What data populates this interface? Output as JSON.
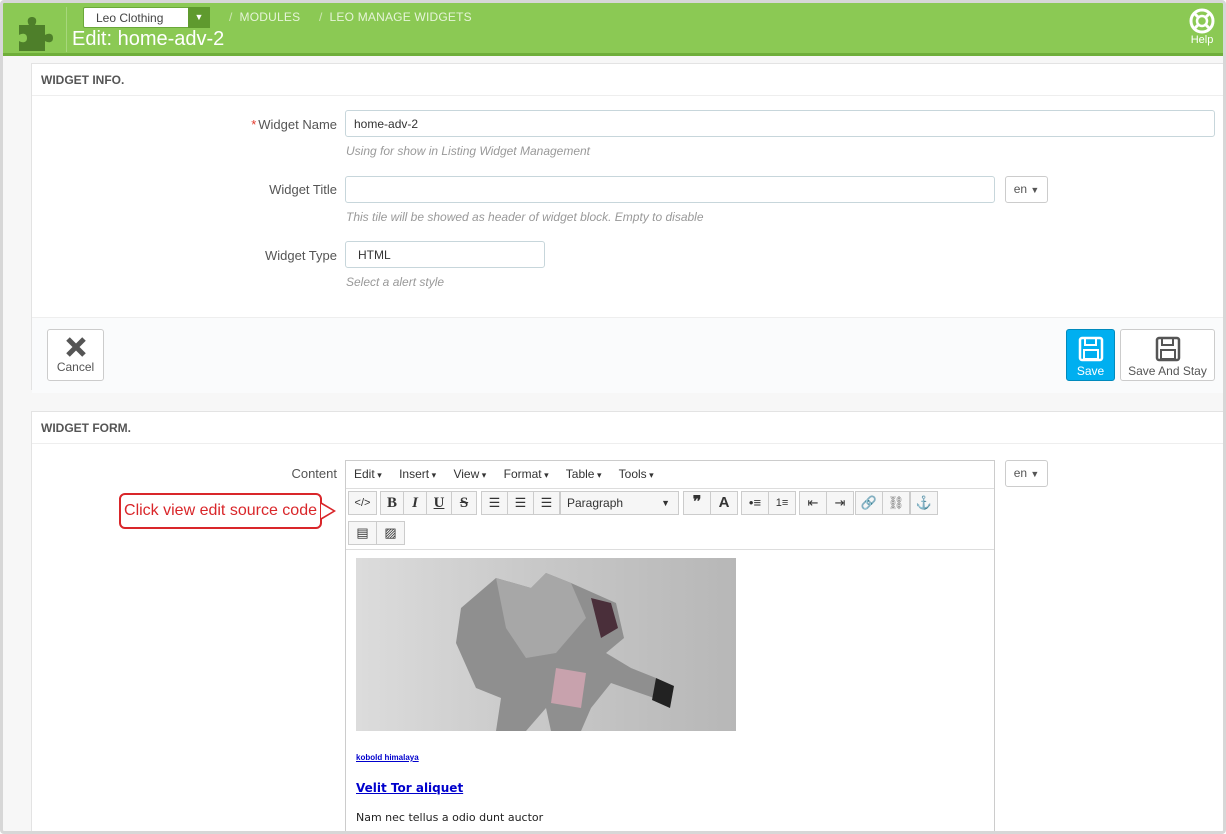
{
  "header": {
    "shop_selector": "Leo Clothing",
    "breadcrumbs": [
      "MODULES",
      "LEO MANAGE WIDGETS"
    ],
    "page_title": "Edit: home-adv-2",
    "help_label": "Help"
  },
  "widget_info": {
    "title": "WIDGET INFO.",
    "name_label": "Widget Name",
    "name_value": "home-adv-2",
    "name_help": "Using for show in Listing Widget Management",
    "title_label": "Widget Title",
    "title_value": "",
    "title_help": "This tile will be showed as header of widget block. Empty to disable",
    "title_lang": "en",
    "type_label": "Widget Type",
    "type_value": "HTML",
    "type_help": "Select a alert style",
    "cancel_label": "Cancel",
    "save_label": "Save",
    "save_stay_label": "Save And Stay"
  },
  "widget_form": {
    "title": "WIDGET FORM.",
    "content_label": "Content",
    "content_lang": "en",
    "menu": [
      "Edit",
      "Insert",
      "View",
      "Format",
      "Table",
      "Tools"
    ],
    "format_select": "Paragraph",
    "callout": "Click view edit source code",
    "content": {
      "small_link": "kobold himalaya",
      "heading_link": "Velit Tor aliquet",
      "paragraph": "Nam nec tellus a odio dunt auctor"
    }
  }
}
